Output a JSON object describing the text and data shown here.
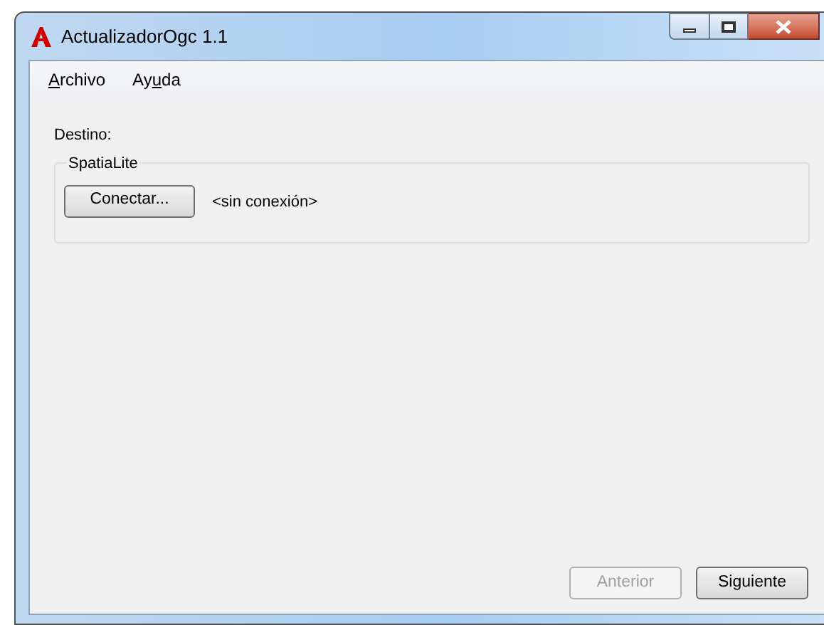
{
  "window": {
    "title": "ActualizadorOgc 1.1"
  },
  "menu": [
    {
      "key": "A",
      "after": "rchivo"
    },
    {
      "before": "Ay",
      "key": "u",
      "after": "da"
    }
  ],
  "destination_label": "Destino:",
  "group": {
    "title": "SpatiaLite",
    "connect_button": "Conectar...",
    "status": "<sin conexión>"
  },
  "buttons": [
    {
      "label": "Anterior",
      "disabled": true
    },
    {
      "label": "Siguiente",
      "disabled": false
    }
  ]
}
